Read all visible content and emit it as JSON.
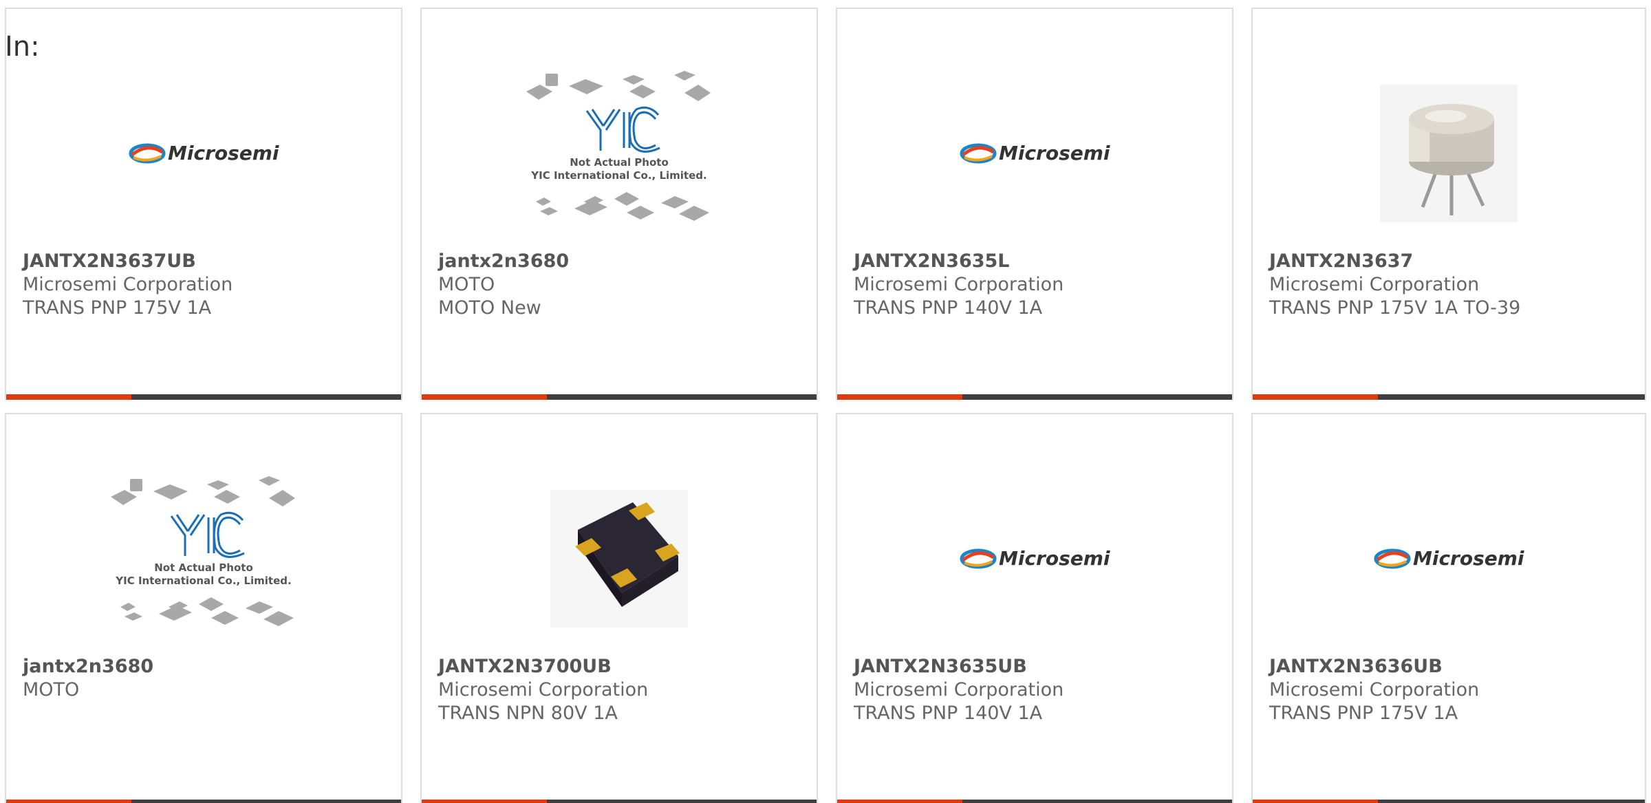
{
  "header": {
    "in_label": "In:"
  },
  "logos": {
    "microsemi": "Microsemi",
    "yic_line1": "Not Actual Photo",
    "yic_line2": "YIC International Co., Limited."
  },
  "colors": {
    "accent": "#e03a0f",
    "bar_dark": "#3f3f3f",
    "text": "#666666",
    "border": "#dddddd"
  },
  "products": [
    {
      "name": "JANTX2N3637UB",
      "manufacturer": "Microsemi Corporation",
      "description": "TRANS PNP 175V 1A",
      "image": "microsemi-logo"
    },
    {
      "name": "jantx2n3680",
      "manufacturer": "MOTO",
      "description": "MOTO New",
      "image": "yic-placeholder"
    },
    {
      "name": "JANTX2N3635L",
      "manufacturer": "Microsemi Corporation",
      "description": "TRANS PNP 140V 1A",
      "image": "microsemi-logo"
    },
    {
      "name": "JANTX2N3637",
      "manufacturer": "Microsemi Corporation",
      "description": "TRANS PNP 175V 1A TO-39",
      "image": "to39-transistor-photo"
    },
    {
      "name": "jantx2n3680",
      "manufacturer": "MOTO",
      "description": "",
      "image": "yic-placeholder"
    },
    {
      "name": "JANTX2N3700UB",
      "manufacturer": "Microsemi Corporation",
      "description": "TRANS NPN 80V 1A",
      "image": "smd-package-photo"
    },
    {
      "name": "JANTX2N3635UB",
      "manufacturer": "Microsemi Corporation",
      "description": "TRANS PNP 140V 1A",
      "image": "microsemi-logo"
    },
    {
      "name": "JANTX2N3636UB",
      "manufacturer": "Microsemi Corporation",
      "description": "TRANS PNP 175V 1A",
      "image": "microsemi-logo"
    }
  ]
}
